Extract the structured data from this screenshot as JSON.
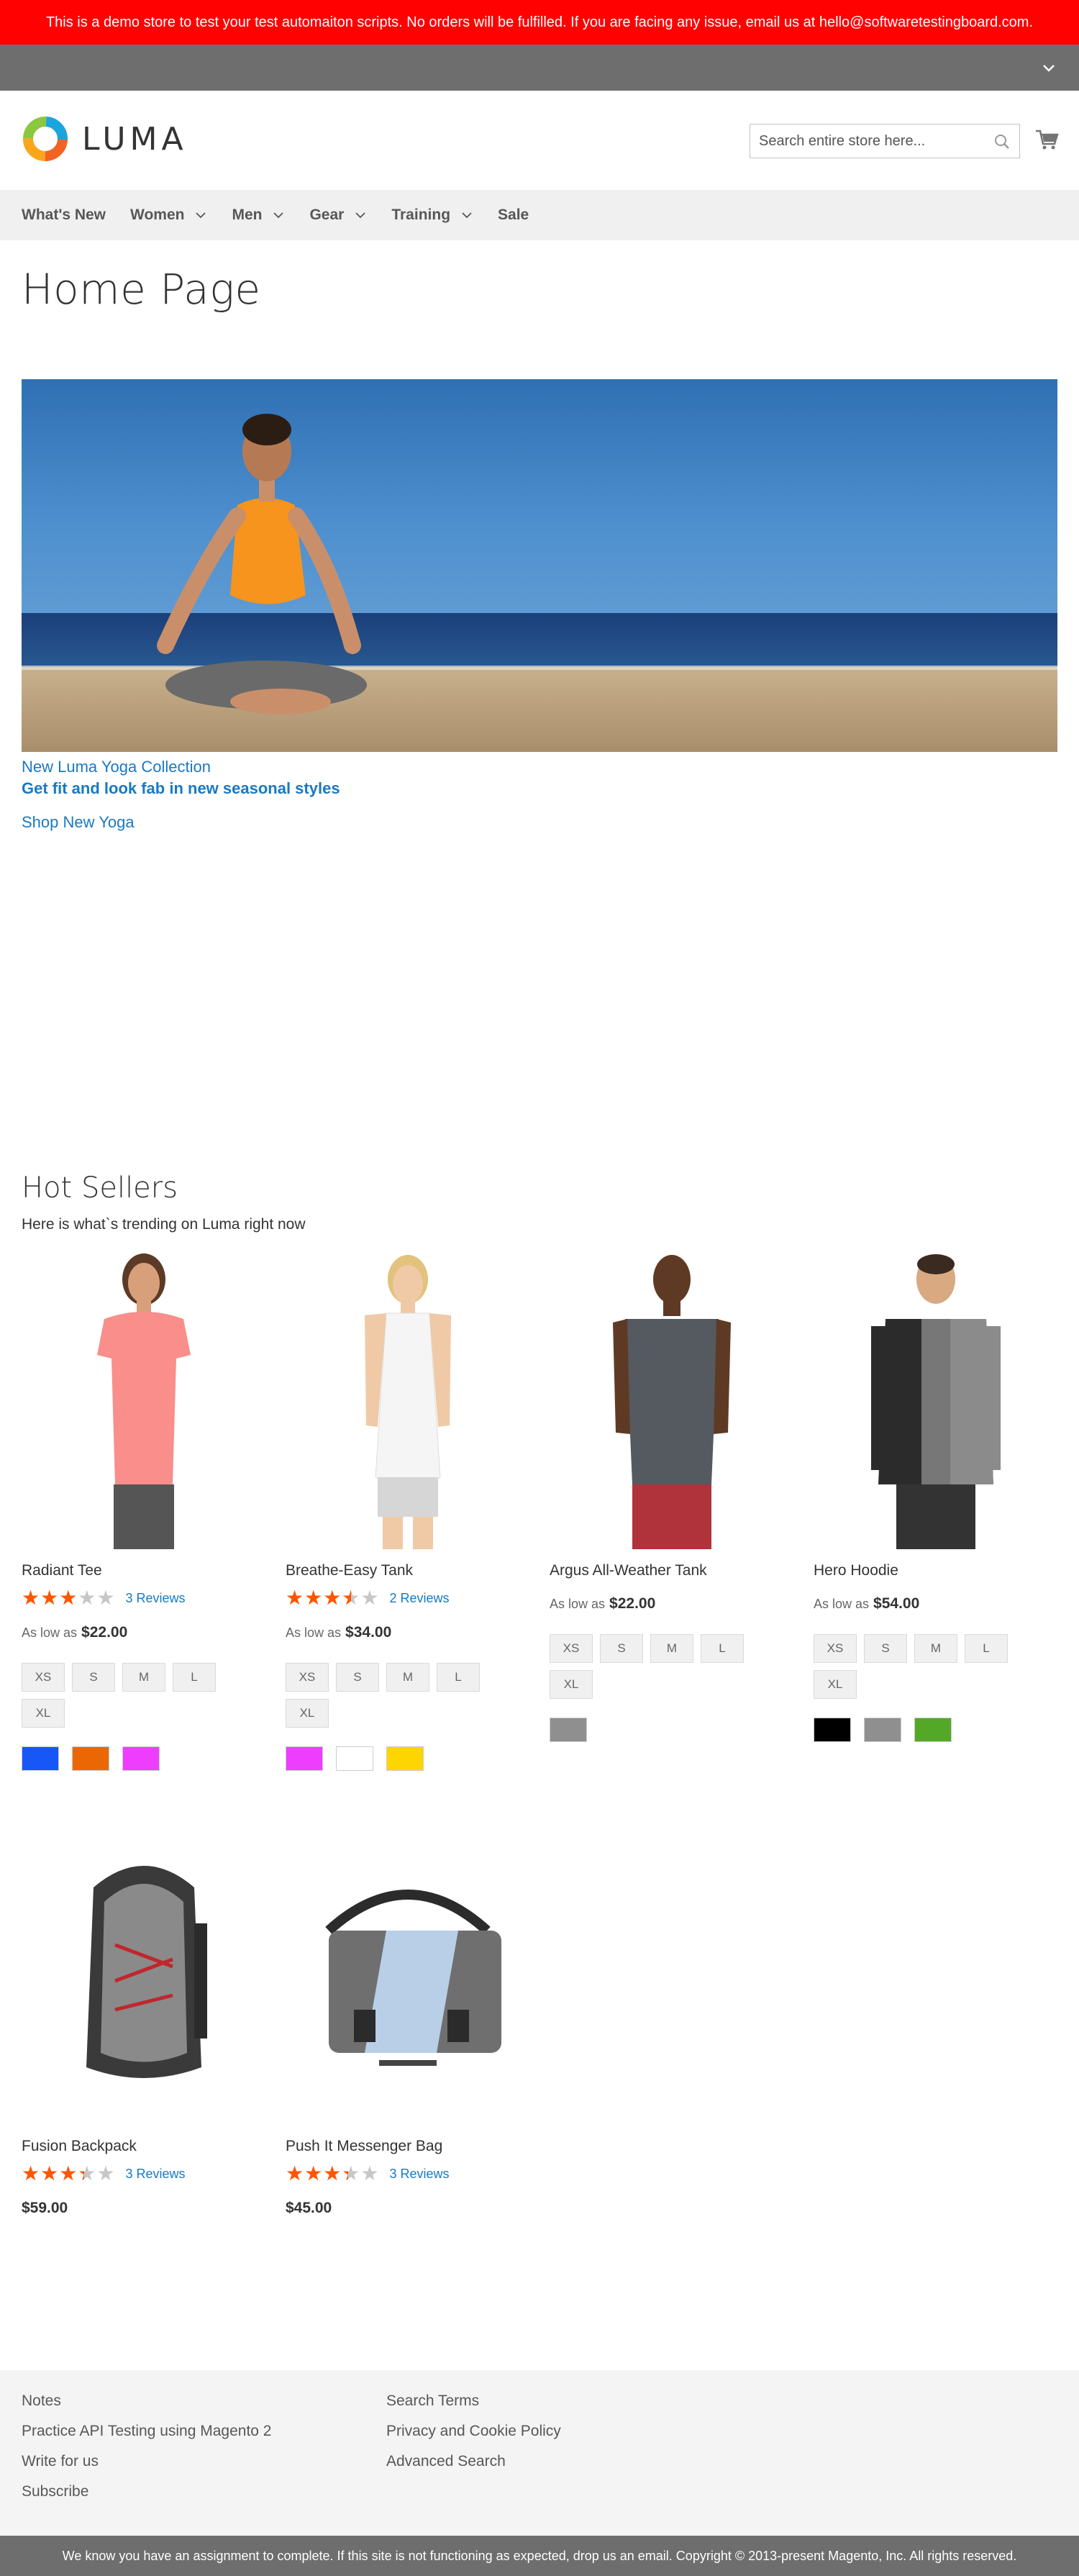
{
  "demo_notice": "This is a demo store to test your test automaiton scripts. No orders will be fulfilled. If you are facing any issue, email us at hello@softwaretestingboard.com.",
  "logo_text": "LUMA",
  "search": {
    "placeholder": "Search entire store here..."
  },
  "nav": [
    {
      "label": "What's New",
      "has_menu": false
    },
    {
      "label": "Women",
      "has_menu": true
    },
    {
      "label": "Men",
      "has_menu": true
    },
    {
      "label": "Gear",
      "has_menu": true
    },
    {
      "label": "Training",
      "has_menu": true
    },
    {
      "label": "Sale",
      "has_menu": false
    }
  ],
  "page_title": "Home Page",
  "hero": {
    "line1": "New Luma Yoga Collection",
    "line2": "Get fit and look fab in new seasonal styles",
    "link": "Shop New Yoga"
  },
  "hot_sellers": {
    "title": "Hot Sellers",
    "subtitle": "Here is what`s trending on Luma right now"
  },
  "products": [
    {
      "name": "Radiant Tee",
      "rating_pct": 60,
      "reviews": "3 Reviews",
      "price_prefix": "As low as",
      "price": "$22.00",
      "sizes": [
        "XS",
        "S",
        "M",
        "L",
        "XL"
      ],
      "colors": [
        "#1857f7",
        "#eb6703",
        "#ef3dff"
      ]
    },
    {
      "name": "Breathe-Easy Tank",
      "rating_pct": 70,
      "reviews": "2 Reviews",
      "price_prefix": "As low as",
      "price": "$34.00",
      "sizes": [
        "XS",
        "S",
        "M",
        "L",
        "XL"
      ],
      "colors": [
        "#ef3dff",
        "#ffffff",
        "#ffd500"
      ]
    },
    {
      "name": "Argus All-Weather Tank",
      "rating_pct": 0,
      "reviews": "",
      "price_prefix": "As low as",
      "price": "$22.00",
      "sizes": [
        "XS",
        "S",
        "M",
        "L",
        "XL"
      ],
      "colors": [
        "#8f8f8f"
      ]
    },
    {
      "name": "Hero Hoodie",
      "rating_pct": 0,
      "reviews": "",
      "price_prefix": "As low as",
      "price": "$54.00",
      "sizes": [
        "XS",
        "S",
        "M",
        "L",
        "XL"
      ],
      "colors": [
        "#000000",
        "#8f8f8f",
        "#53a828"
      ]
    },
    {
      "name": "Fusion Backpack",
      "rating_pct": 67,
      "reviews": "3 Reviews",
      "price_prefix": "",
      "price": "$59.00",
      "sizes": [],
      "colors": []
    },
    {
      "name": "Push It Messenger Bag",
      "rating_pct": 67,
      "reviews": "3 Reviews",
      "price_prefix": "",
      "price": "$45.00",
      "sizes": [],
      "colors": []
    }
  ],
  "footer": {
    "col1": [
      "Notes",
      "Practice API Testing using Magento 2",
      "Write for us",
      "Subscribe"
    ],
    "col2": [
      "Search Terms",
      "Privacy and Cookie Policy",
      "Advanced Search"
    ]
  },
  "copyright": "We know you have an assignment to complete. If this site is not functioning as expected, drop us an email. Copyright © 2013-present Magento, Inc. All rights reserved.",
  "colors": {
    "accent_link": "#1979c3",
    "demo_banner": "#ff0101",
    "star": "#ff5501",
    "bar": "#6e6e6e"
  },
  "icons": {
    "search": "search-icon",
    "cart": "cart-icon",
    "toggle": "chevron-down-icon"
  }
}
